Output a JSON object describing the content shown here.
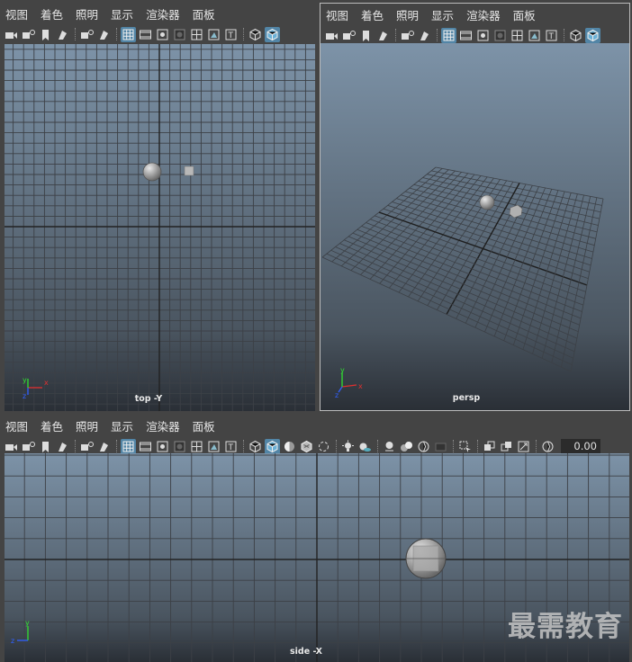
{
  "menu": [
    "视图",
    "着色",
    "照明",
    "显示",
    "渲染器",
    "面板"
  ],
  "viewports": {
    "top": {
      "label": "top -Y"
    },
    "persp": {
      "label": "persp"
    },
    "side": {
      "label": "side -X"
    }
  },
  "axes": {
    "x": "x",
    "y": "y",
    "z": "z"
  },
  "toolbar": {
    "value_field": "0.00"
  },
  "watermark": "最需教育",
  "colors": {
    "viewport_top": "#7d93a8",
    "viewport_bottom": "#2a2f36",
    "grid": "#3c4046",
    "axis_x": "#e03030",
    "axis_y": "#30e030",
    "axis_z": "#3060ff",
    "highlight": "#5285a6"
  },
  "icons": [
    "camera-icon",
    "camera-attrs-icon",
    "bookmark-icon",
    "image-plane-icon",
    "grid-icon",
    "film-gate-icon",
    "resolution-gate-icon",
    "gate-mask-icon",
    "field-chart-icon",
    "safe-action-icon",
    "safe-title-icon",
    "wireframe-icon",
    "smooth-shade-icon",
    "textured-icon",
    "lights-icon",
    "shadows-icon",
    "isolate-icon",
    "xray-icon"
  ]
}
